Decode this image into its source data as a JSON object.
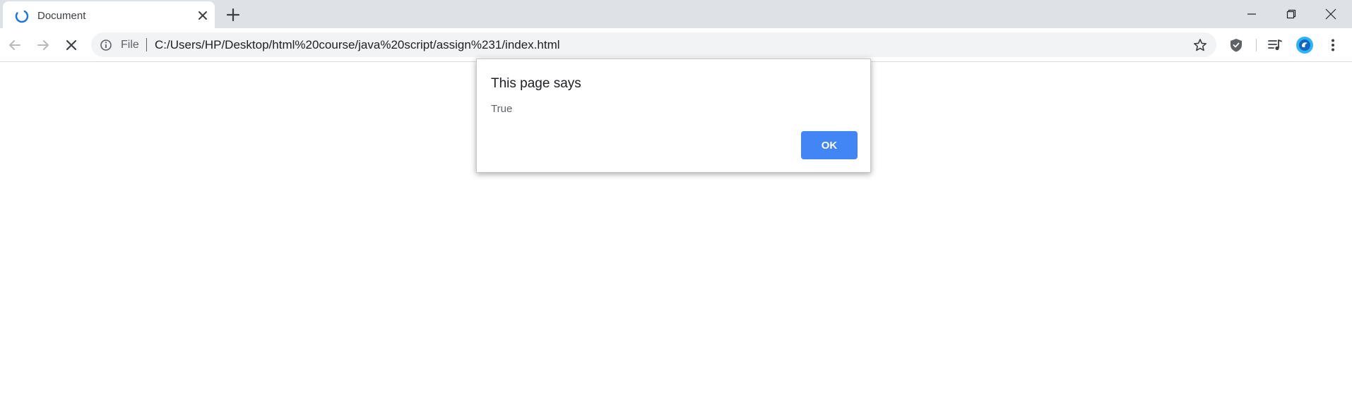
{
  "tab": {
    "title": "Document",
    "status": "loading"
  },
  "nav": {
    "back_enabled": false,
    "forward_enabled": false,
    "action": "stop"
  },
  "omnibox": {
    "scheme_label": "File",
    "url": "C:/Users/HP/Desktop/html%20course/java%20script/assign%231/index.html"
  },
  "dialog": {
    "title": "This page says",
    "message": "True",
    "ok_label": "OK"
  },
  "colors": {
    "accent": "#4285f4",
    "tabstrip": "#dee1e6",
    "omnibox": "#f1f3f4",
    "spinner": "#1a73e8",
    "profile": "#29b6f6"
  },
  "icons": [
    "spinner-icon",
    "close-icon",
    "plus-icon",
    "minimize-icon",
    "restore-icon",
    "window-close-icon",
    "back-arrow-icon",
    "forward-arrow-icon",
    "stop-icon",
    "info-icon",
    "star-icon",
    "shield-extension-icon",
    "media-control-icon",
    "profile-avatar-icon",
    "more-vert-icon"
  ]
}
